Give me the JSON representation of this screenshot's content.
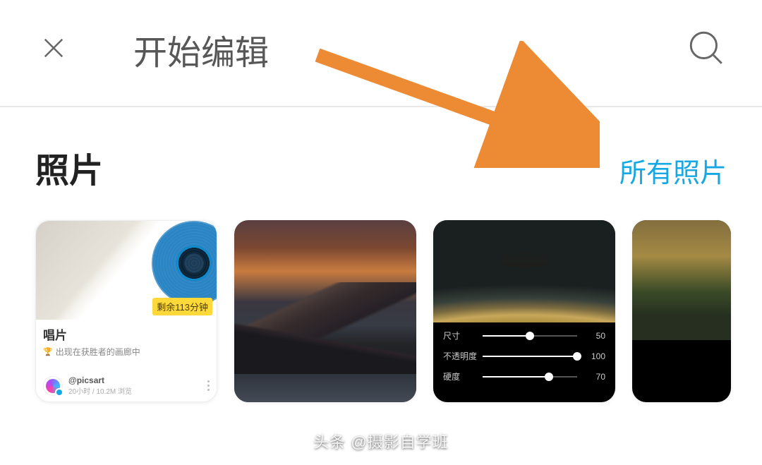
{
  "header": {
    "title": "开始编辑"
  },
  "section": {
    "title": "照片",
    "all_link": "所有照片"
  },
  "cards": {
    "record": {
      "badge": "剩余113分钟",
      "title": "唱片",
      "subtitle": "出现在获胜者的画廊中",
      "username": "@picsart",
      "meta": "20小时 / 10.2M 浏览"
    },
    "sliders": {
      "size_label": "尺寸",
      "size_value": "50",
      "opacity_label": "不透明度",
      "opacity_value": "100",
      "hardness_label": "硬度",
      "hardness_value": "70"
    }
  },
  "watermark": "头条 @摄影自学班"
}
